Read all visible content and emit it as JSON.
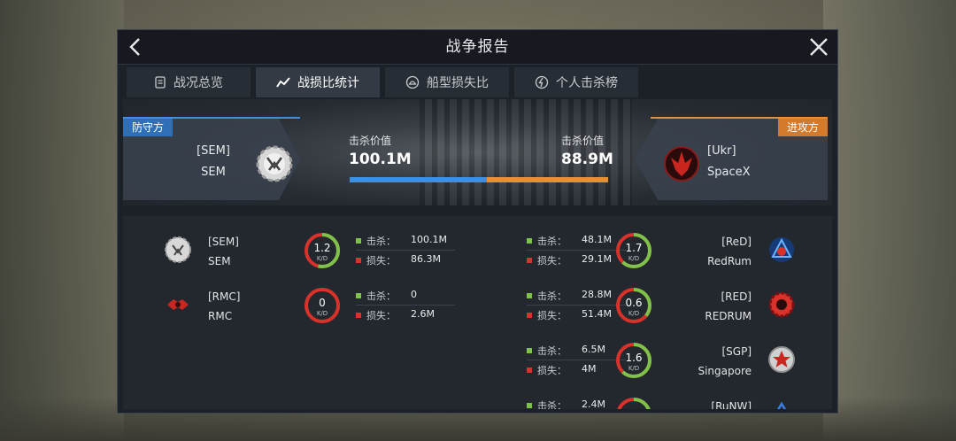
{
  "window": {
    "title": "战争报告"
  },
  "tabs": [
    {
      "label": "战况总览",
      "icon": "document-icon",
      "active": false
    },
    {
      "label": "战损比统计",
      "icon": "trend-line-icon",
      "active": true
    },
    {
      "label": "船型损失比",
      "icon": "ship-icon",
      "active": false
    },
    {
      "label": "个人击杀榜",
      "icon": "lightning-icon",
      "active": false
    }
  ],
  "defender": {
    "role_label": "防守方",
    "tag": "[SEM]",
    "name": "SEM",
    "kill_value_label": "击杀价值",
    "kill_value": "100.1M",
    "accent": "#3f8ee0",
    "kill_share": 0.53
  },
  "attacker": {
    "role_label": "进攻方",
    "tag": "[Ukr]",
    "name": "SpaceX",
    "kill_value_label": "击杀价值",
    "kill_value": "88.9M",
    "accent": "#e0913a",
    "kill_share": 0.47
  },
  "stat_labels": {
    "kills": "击杀：",
    "losses": "损失：",
    "kd": "K/D"
  },
  "defender_rows": [
    {
      "tag": "[SEM]",
      "name": "SEM",
      "kd": "1.2",
      "kills": "100.1M",
      "losses": "86.3M",
      "kd_ratio": 0.54
    },
    {
      "tag": "[RMC]",
      "name": "RMC",
      "kd": "0",
      "kills": "0",
      "losses": "2.6M",
      "kd_ratio": 0.0
    }
  ],
  "attacker_rows": [
    {
      "tag": "[ReD]",
      "name": "RedRum",
      "kd": "1.7",
      "kills": "48.1M",
      "losses": "29.1M",
      "kd_ratio": 0.62
    },
    {
      "tag": "[RED]",
      "name": "REDRUM",
      "kd": "0.6",
      "kills": "28.8M",
      "losses": "51.4M",
      "kd_ratio": 0.36
    },
    {
      "tag": "[SGP]",
      "name": "Singapore",
      "kd": "1.6",
      "kills": "6.5M",
      "losses": "4M",
      "kd_ratio": 0.62
    },
    {
      "tag": "[RuNW]",
      "name": "",
      "kd": "",
      "kills": "2.4M",
      "losses": "",
      "kd_ratio": 0.5
    }
  ],
  "colors": {
    "kd_good": "#7ec24a",
    "kd_bad": "#d8322a"
  }
}
